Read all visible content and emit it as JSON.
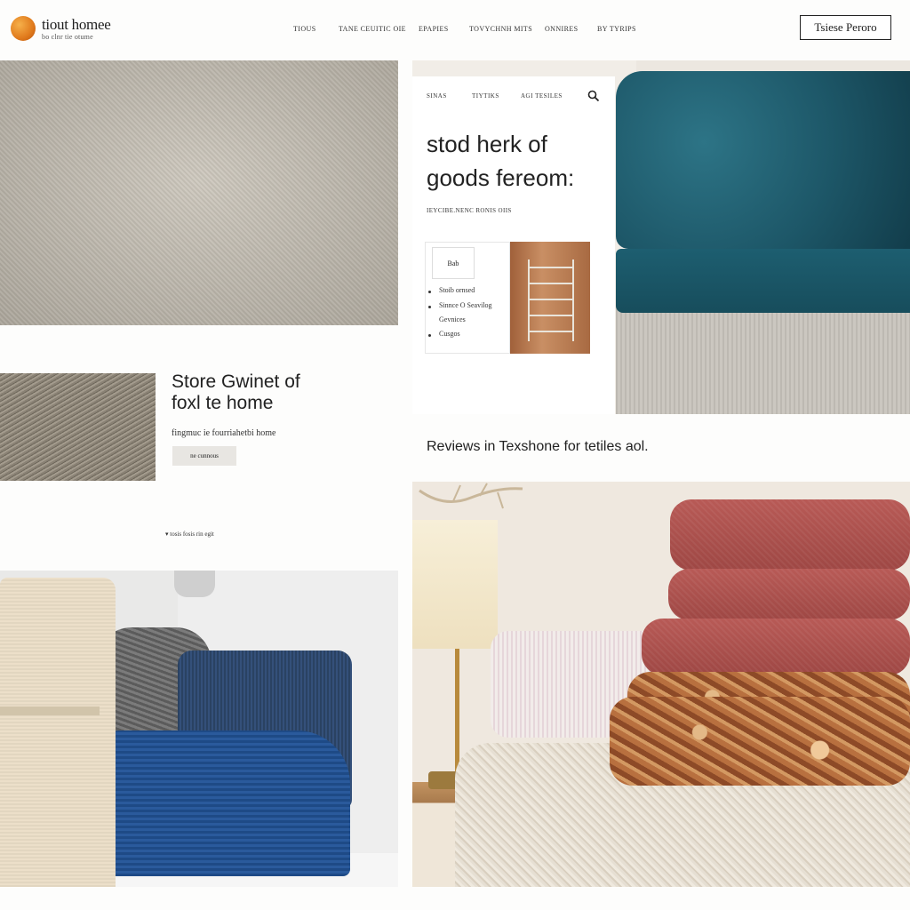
{
  "brand": {
    "name": "tiout homee",
    "tagline": "bo clnr tie otume"
  },
  "nav": {
    "items": [
      "tious",
      "tane ceuitic oie",
      "epapies",
      "tovychnh mits",
      "onnires",
      "by tyrips"
    ]
  },
  "header": {
    "button_label": "Tsiese Peroro"
  },
  "hero": {
    "nav_items": [
      "sinas",
      "tiytiks",
      "agi tesiles"
    ],
    "title_line1": "stod herk of",
    "title_line2": "goods fereom:",
    "subtitle": "ieycibe.nenc ronis oiis",
    "mini_card_label": "Bab",
    "list_items": [
      "Stoib ornsed",
      "Sinnce O Seavilog",
      "Gevnices",
      "Cusgos"
    ]
  },
  "section": {
    "title_line1": "Store Gwinet of",
    "title_line2": "foxl te home",
    "subtitle": "fingmuc ie fourriahetbi home",
    "button_label": "ne cunnous",
    "small_link": "tosis fosis rin egit"
  },
  "reviews": {
    "text": "Reviews in Texshone for tetiles aol."
  },
  "colors": {
    "accent": "#e07a1c",
    "teal": "#1d5768",
    "navy": "#1e4a86",
    "terracotta": "#a74d4a"
  },
  "icons": {
    "search": "search-icon",
    "logo": "logo-icon",
    "chevron": "chevron-down-icon"
  }
}
